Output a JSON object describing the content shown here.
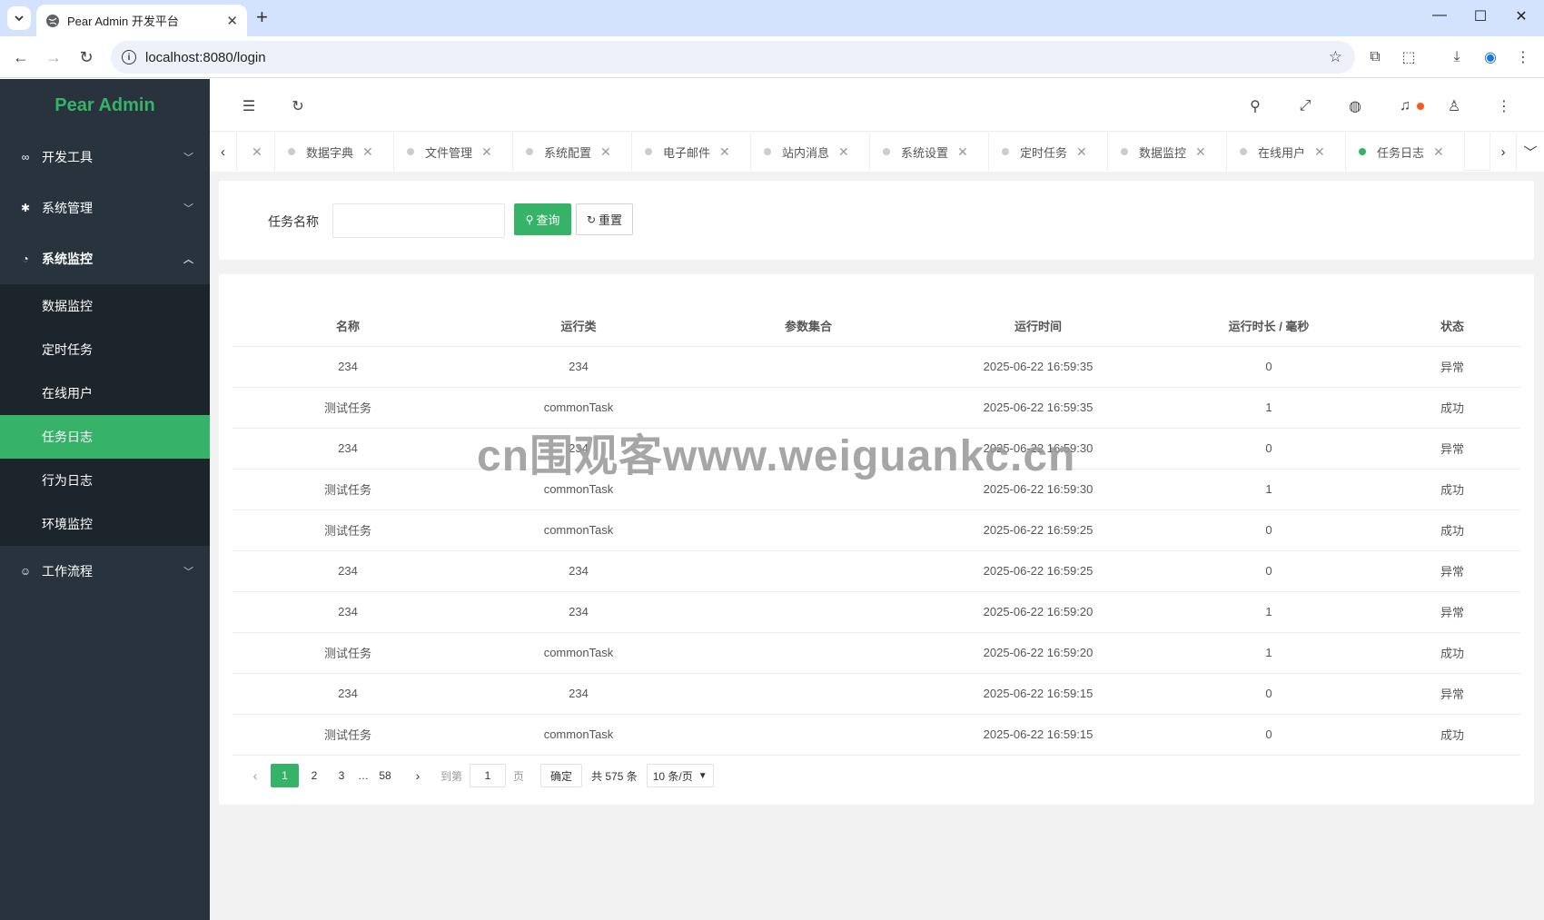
{
  "browser": {
    "tab_title": "Pear Admin 开发平台",
    "url": "localhost:8080/login"
  },
  "app": {
    "logo": "Pear Admin",
    "accent": "#36b368",
    "sidebar_bg": "#28333e"
  },
  "sidebar": {
    "groups": [
      {
        "label": "开发工具",
        "icon": "link-icon"
      },
      {
        "label": "系统管理",
        "icon": "gear-icon"
      },
      {
        "label": "系统监控",
        "icon": "dashboard-icon"
      },
      {
        "label": "工作流程",
        "icon": "smile-icon"
      }
    ],
    "sub_items": [
      {
        "label": "数据监控"
      },
      {
        "label": "定时任务"
      },
      {
        "label": "在线用户"
      },
      {
        "label": "任务日志"
      },
      {
        "label": "行为日志"
      },
      {
        "label": "环境监控"
      }
    ]
  },
  "tabs": [
    {
      "label": "数据字典"
    },
    {
      "label": "文件管理"
    },
    {
      "label": "系统配置"
    },
    {
      "label": "电子邮件"
    },
    {
      "label": "站内消息"
    },
    {
      "label": "系统设置"
    },
    {
      "label": "定时任务"
    },
    {
      "label": "数据监控"
    },
    {
      "label": "在线用户"
    },
    {
      "label": "任务日志"
    }
  ],
  "filter": {
    "label": "任务名称",
    "query_label": "查询",
    "reset_label": "重置"
  },
  "table": {
    "headers": [
      "名称",
      "运行类",
      "参数集合",
      "运行时间",
      "运行时长 / 毫秒",
      "状态"
    ],
    "rows": [
      {
        "name": "234",
        "cls": "234",
        "params": "",
        "time": "2025-06-22 16:59:35",
        "ms": "0",
        "status": "异常",
        "ok": false
      },
      {
        "name": "测试任务",
        "cls": "commonTask",
        "params": "",
        "time": "2025-06-22 16:59:35",
        "ms": "1",
        "status": "成功",
        "ok": true
      },
      {
        "name": "234",
        "cls": "234",
        "params": "",
        "time": "2025-06-22 16:59:30",
        "ms": "0",
        "status": "异常",
        "ok": false
      },
      {
        "name": "测试任务",
        "cls": "commonTask",
        "params": "",
        "time": "2025-06-22 16:59:30",
        "ms": "1",
        "status": "成功",
        "ok": true
      },
      {
        "name": "测试任务",
        "cls": "commonTask",
        "params": "",
        "time": "2025-06-22 16:59:25",
        "ms": "0",
        "status": "成功",
        "ok": true
      },
      {
        "name": "234",
        "cls": "234",
        "params": "",
        "time": "2025-06-22 16:59:25",
        "ms": "0",
        "status": "异常",
        "ok": false
      },
      {
        "name": "234",
        "cls": "234",
        "params": "",
        "time": "2025-06-22 16:59:20",
        "ms": "1",
        "status": "异常",
        "ok": false
      },
      {
        "name": "测试任务",
        "cls": "commonTask",
        "params": "",
        "time": "2025-06-22 16:59:20",
        "ms": "1",
        "status": "成功",
        "ok": true
      },
      {
        "name": "234",
        "cls": "234",
        "params": "",
        "time": "2025-06-22 16:59:15",
        "ms": "0",
        "status": "异常",
        "ok": false
      },
      {
        "name": "测试任务",
        "cls": "commonTask",
        "params": "",
        "time": "2025-06-22 16:59:15",
        "ms": "0",
        "status": "成功",
        "ok": true
      }
    ]
  },
  "pager": {
    "pages": [
      "1",
      "2",
      "3"
    ],
    "ellipsis": "…",
    "last": "58",
    "goto_label": "到第",
    "goto_value": "1",
    "page_unit": "页",
    "confirm": "确定",
    "total": "共 575 条",
    "per_page": "10 条/页"
  },
  "watermark": "cn围观客www.weiguankc.cn"
}
